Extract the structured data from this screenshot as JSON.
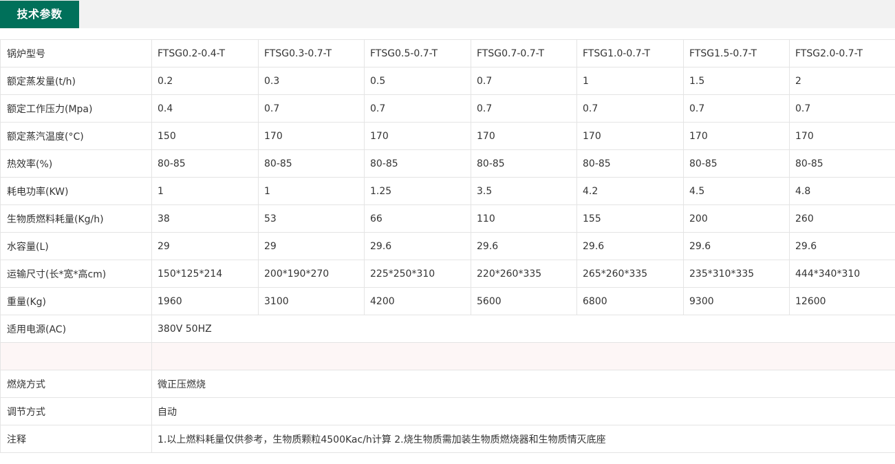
{
  "section": {
    "title": "技术参数"
  },
  "models_row": {
    "label": "锅炉型号",
    "values": [
      "FTSG0.2-0.4-T",
      "FTSG0.3-0.7-T",
      "FTSG0.5-0.7-T",
      "FTSG0.7-0.7-T",
      "FTSG1.0-0.7-T",
      "FTSG1.5-0.7-T",
      "FTSG2.0-0.7-T"
    ]
  },
  "rows": [
    {
      "label": "额定蒸发量(t/h)",
      "values": [
        "0.2",
        "0.3",
        "0.5",
        "0.7",
        "1",
        "1.5",
        "2"
      ]
    },
    {
      "label": "额定工作压力(Mpa)",
      "values": [
        "0.4",
        "0.7",
        "0.7",
        "0.7",
        "0.7",
        "0.7",
        "0.7"
      ]
    },
    {
      "label": "额定蒸汽温度(°C)",
      "values": [
        "150",
        "170",
        "170",
        "170",
        "170",
        "170",
        "170"
      ]
    },
    {
      "label": "热效率(%)",
      "values": [
        "80-85",
        "80-85",
        "80-85",
        "80-85",
        "80-85",
        "80-85",
        "80-85"
      ]
    },
    {
      "label": "耗电功率(KW)",
      "values": [
        "1",
        "1",
        "1.25",
        "3.5",
        "4.2",
        "4.5",
        "4.8"
      ]
    },
    {
      "label": "生物质燃料耗量(Kg/h)",
      "values": [
        "38",
        "53",
        "66",
        "110",
        "155",
        "200",
        "260"
      ]
    },
    {
      "label": "水容量(L)",
      "values": [
        "29",
        "29",
        "29.6",
        "29.6",
        "29.6",
        "29.6",
        "29.6"
      ]
    },
    {
      "label": "运输尺寸(长*宽*高cm)",
      "values": [
        "150*125*214",
        "200*190*270",
        "225*250*310",
        "220*260*335",
        "265*260*335",
        "235*310*335",
        "444*340*310"
      ]
    },
    {
      "label": "重量(Kg)",
      "values": [
        "1960",
        "3100",
        "4200",
        "5600",
        "6800",
        "9300",
        "12600"
      ]
    }
  ],
  "wide_rows": {
    "power_supply": {
      "label": "适用电源(AC)",
      "value": "380V 50HZ"
    },
    "combustion": {
      "label": "燃烧方式",
      "value": "微正压燃烧"
    },
    "regulation": {
      "label": "调节方式",
      "value": "自动"
    },
    "notes": {
      "label": "注释",
      "value": "1.以上燃料耗量仅供参考，生物质颗粒4500Kac/h计算 2.烧生物质需加装生物质燃烧器和生物质情灭底座"
    }
  }
}
